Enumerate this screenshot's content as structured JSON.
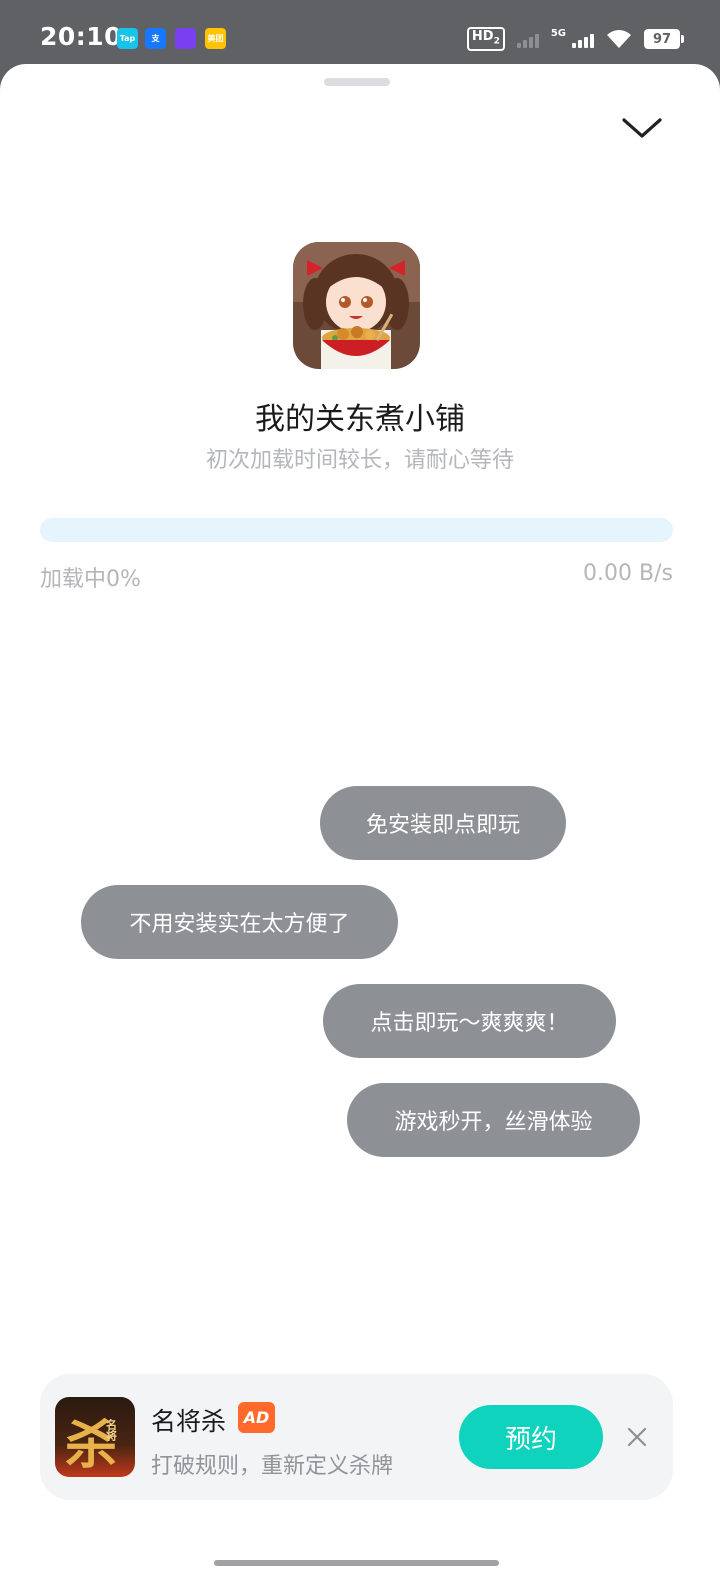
{
  "status_bar": {
    "time": "20:10",
    "notifications": [
      {
        "name": "taptap-notification-icon",
        "label": "Tap",
        "color": "#17c3e8"
      },
      {
        "name": "alipay-notification-icon",
        "label": "支",
        "color": "#1677ff"
      },
      {
        "name": "game-app-notification-icon",
        "label": "",
        "color": "#7b3ff2"
      },
      {
        "name": "meituan-notification-icon",
        "label": "美团",
        "color": "#ffc300"
      }
    ],
    "hd_label": "HD",
    "hd_sub": "2",
    "network": "5G",
    "battery": "97"
  },
  "app": {
    "title": "我的关东煮小铺",
    "subtitle": "初次加载时间较长，请耐心等待"
  },
  "progress": {
    "label": "加载中0%",
    "percent": 0,
    "speed": "0.00 B/s"
  },
  "bubbles": [
    "免安装即点即玩",
    "不用安装实在太方便了",
    "点击即玩～爽爽爽！",
    "游戏秒开，丝滑体验"
  ],
  "ad": {
    "title": "名将杀",
    "badge": "AD",
    "description": "打破规则，重新定义杀牌",
    "button": "预约",
    "icon_text": "杀",
    "icon_small_text": "名将"
  },
  "colors": {
    "accent": "#10d3bd",
    "progress_track": "#e6f4fd",
    "bubble": "#8d9095",
    "ad_badge": "#ff6a2c"
  }
}
